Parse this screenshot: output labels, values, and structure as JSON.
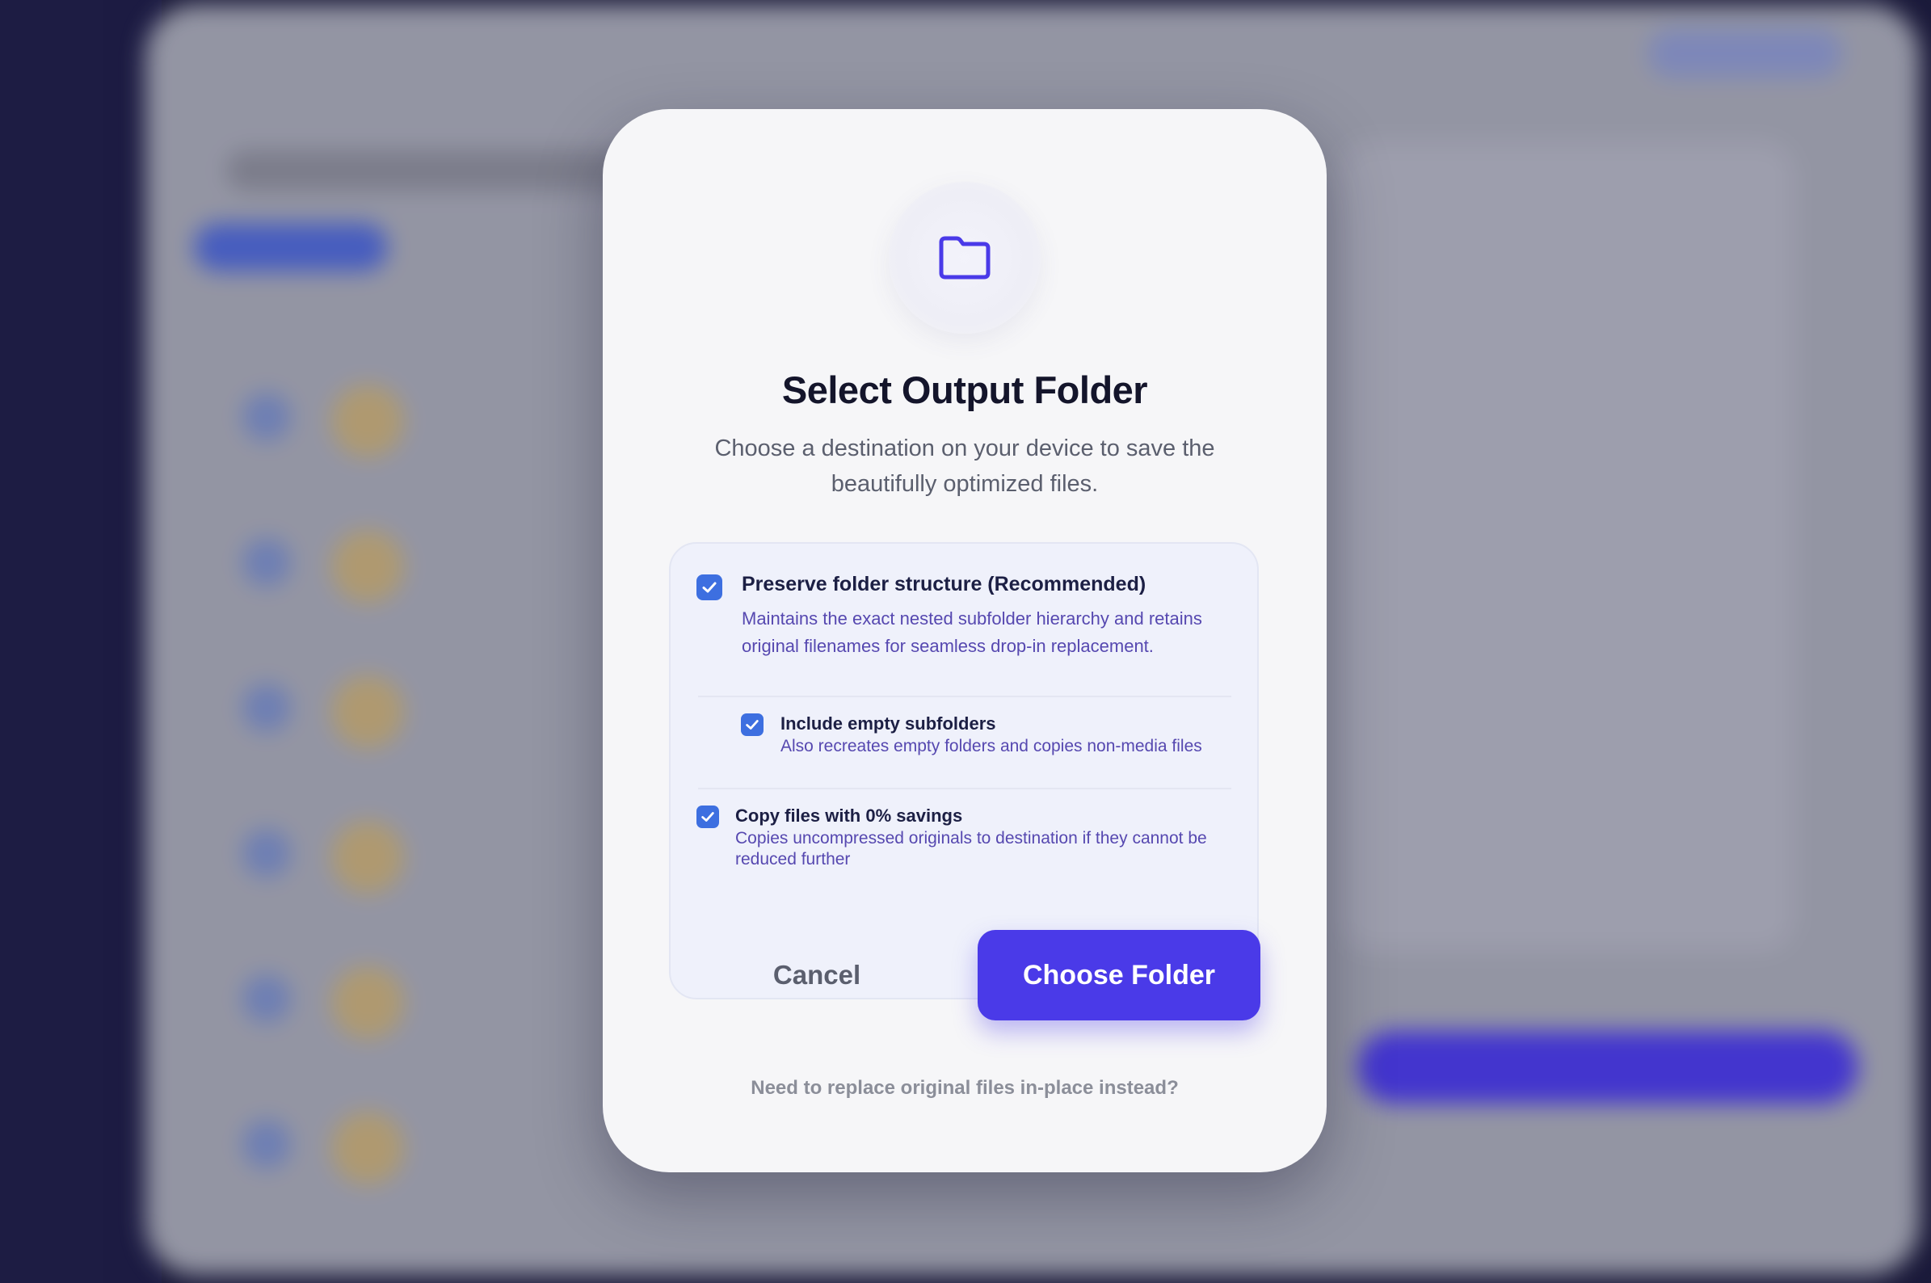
{
  "modal": {
    "icon": "folder-icon",
    "title": "Select Output Folder",
    "subtitle": "Choose a destination on your device to save the beautifully optimized files.",
    "options": {
      "preserve": {
        "checked": true,
        "title": "Preserve folder structure (Recommended)",
        "description": "Maintains the exact nested subfolder hierarchy and retains original filenames for seamless drop-in replacement."
      },
      "empty": {
        "checked": true,
        "title": "Include empty subfolders",
        "description": "Also recreates empty folders and copies non-media files"
      },
      "copy": {
        "checked": true,
        "title": "Copy files with 0% savings",
        "description": "Copies uncompressed originals to destination if they cannot be reduced further"
      }
    },
    "cancel_label": "Cancel",
    "choose_label": "Choose Folder",
    "alt_link": "Need to replace original files in-place instead?"
  },
  "colors": {
    "accent": "#4a3ae8",
    "checkbox": "#3d6fe0",
    "title": "#14152b",
    "muted": "#5b5f6e",
    "option_desc": "#5648b0"
  }
}
